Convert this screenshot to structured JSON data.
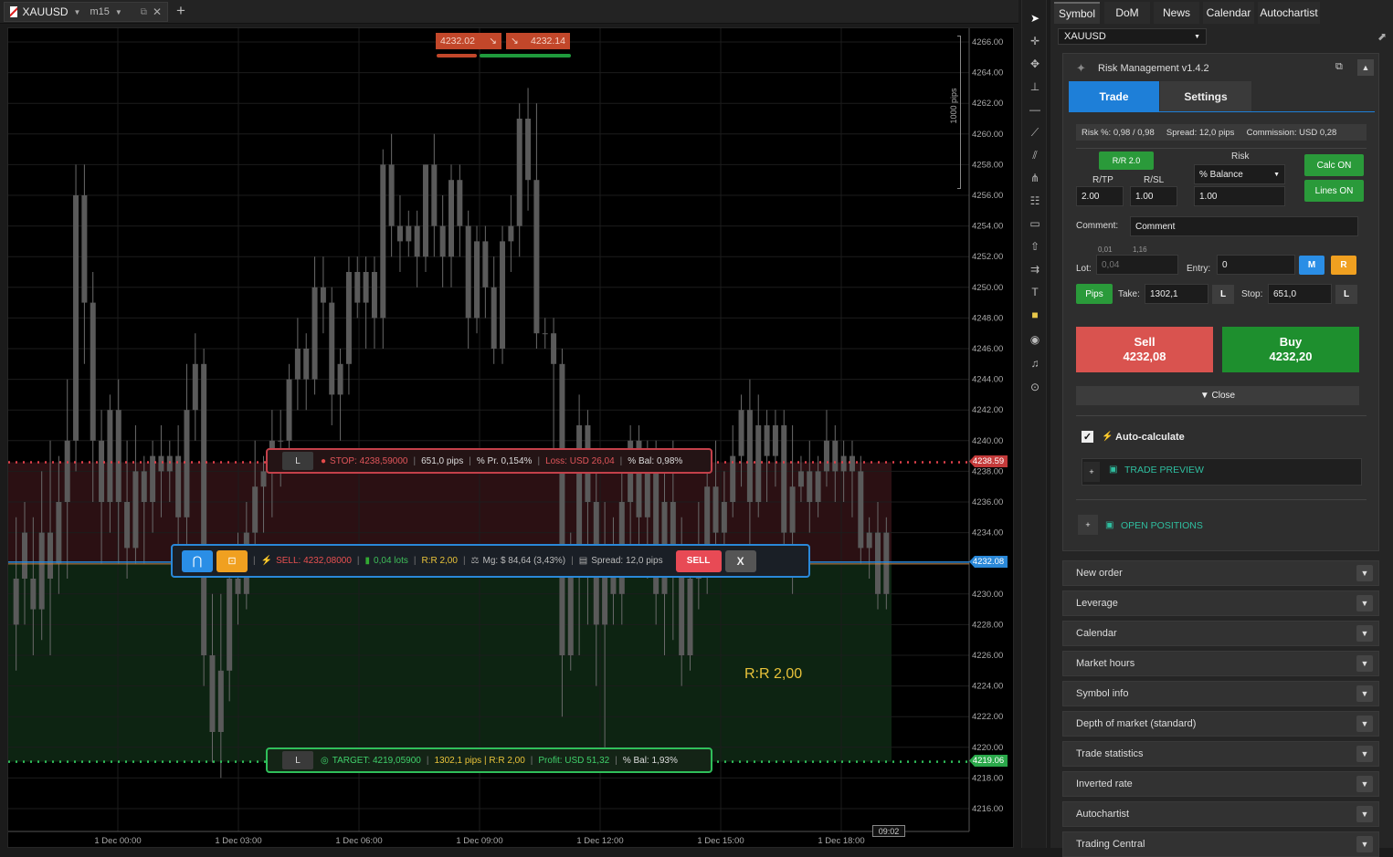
{
  "tab": {
    "symbol": "XAUUSD",
    "timeframe": "m15",
    "add": "+"
  },
  "chart": {
    "price_ticks": [
      "4266.00",
      "4264.00",
      "4262.00",
      "4260.00",
      "4258.00",
      "4256.00",
      "4254.00",
      "4252.00",
      "4250.00",
      "4248.00",
      "4246.00",
      "4244.00",
      "4242.00",
      "4240.00",
      "4238.00",
      "4236.00",
      "4234.00",
      "4232.00",
      "4230.00",
      "4228.00",
      "4226.00",
      "4224.00",
      "4222.00",
      "4220.00",
      "4218.00",
      "4216.00"
    ],
    "time_ticks": [
      "1 Dec 00:00",
      "1 Dec 03:00",
      "1 Dec 06:00",
      "1 Dec 09:00",
      "1 Dec 12:00",
      "1 Dec 15:00",
      "1 Dec 18:00"
    ],
    "cursor_time": "09:02",
    "ruler": "1000 pips",
    "sell_quote": "4232.02",
    "buy_quote": "4232.14",
    "stop_tag": "4238.59",
    "entry_tag": "4232.08",
    "target_tag": "4219.06",
    "rr_text": "R:R 2,00"
  },
  "stop_bar": {
    "l": "L",
    "stop": "STOP: 4238,59000",
    "pips": "651,0 pips",
    "pr": "% Pr. 0,154%",
    "loss": "Loss: USD 26,04",
    "bal": "% Bal: 0,98%"
  },
  "entry_bar": {
    "sell": "SELL: 4232,08000",
    "lots": "0,04 lots",
    "rr": "R:R 2,00",
    "mg": "Mg: $ 84,64 (3,43%)",
    "spread": "Spread: 12,0 pips",
    "sell_btn": "SELL",
    "close_btn": "X"
  },
  "target_bar": {
    "l": "L",
    "target": "TARGET: 4219,05900",
    "pips": "1302,1 pips | R:R 2,00",
    "profit": "Profit: USD 51,32",
    "bal": "% Bal: 1,93%"
  },
  "right_tabs": [
    "Symbol",
    "DoM",
    "News",
    "Calendar",
    "Autochartist"
  ],
  "symbol_select": "XAUUSD",
  "rm": {
    "title": "Risk Management v1.4.2",
    "tab_trade": "Trade",
    "tab_settings": "Settings",
    "info": "Risk %: 0,98 / 0,98     Spread: 12,0 pips     Commission: USD 0,28",
    "rr_btn": "R/R 2.0",
    "rtp_label": "R/TP",
    "rsl_label": "R/SL",
    "rtp": "2.00",
    "rsl": "1.00",
    "risk_label": "Risk",
    "risk_mode": "% Balance",
    "risk_val": "1.00",
    "calc_btn": "Calc ON",
    "lines_btn": "Lines ON",
    "comment_label": "Comment:",
    "comment": "Comment",
    "lot_min": "0,01",
    "lot_max": "1,16",
    "lot_label": "Lot:",
    "lot": "0,04",
    "entry_label": "Entry:",
    "entry": "0",
    "m_btn": "M",
    "r_btn": "R",
    "pips_btn": "Pips",
    "take_label": "Take:",
    "take": "1302,1",
    "stop_label": "Stop:",
    "stop": "651,0",
    "l_btn": "L",
    "sell_label": "Sell",
    "sell_price": "4232,08",
    "buy_label": "Buy",
    "buy_price": "4232,20",
    "close": "▼ Close",
    "auto": "Auto-calculate",
    "preview": "TRADE PREVIEW",
    "positions": "OPEN POSITIONS"
  },
  "accordion": [
    "New order",
    "Leverage",
    "Calendar",
    "Market hours",
    "Symbol info",
    "Depth of market (standard)",
    "Trade statistics",
    "Inverted rate",
    "Autochartist",
    "Trading Central"
  ]
}
